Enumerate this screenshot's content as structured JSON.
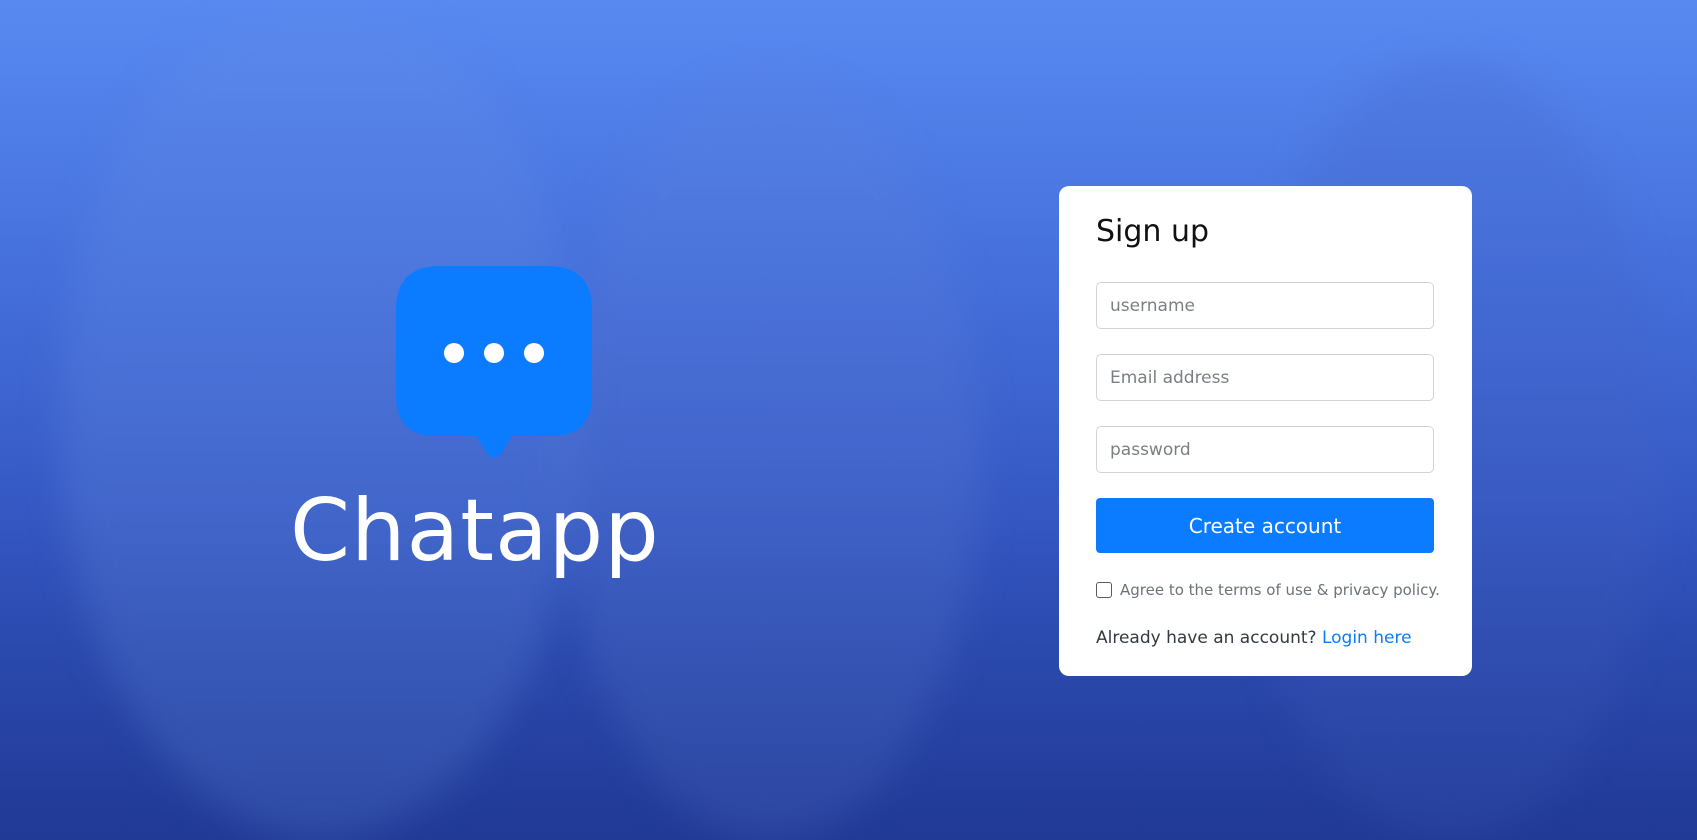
{
  "brand": {
    "name": "Chatapp",
    "logo_icon": "chat-bubble-dots-icon",
    "logo_color": "#0B7CFF"
  },
  "signup": {
    "title": "Sign up",
    "username_placeholder": "username",
    "email_placeholder": "Email address",
    "password_placeholder": "password",
    "username_value": "",
    "email_value": "",
    "password_value": "",
    "submit_label": "Create account",
    "terms_label": "Agree to the terms of use & privacy policy.",
    "terms_checked": false,
    "login_prompt": "Already have an account?",
    "login_link": "Login here"
  },
  "colors": {
    "accent": "#0B7CFF",
    "background_top": "#5A8CF2",
    "background_bottom": "#2440A0",
    "card": "#FFFFFF"
  }
}
